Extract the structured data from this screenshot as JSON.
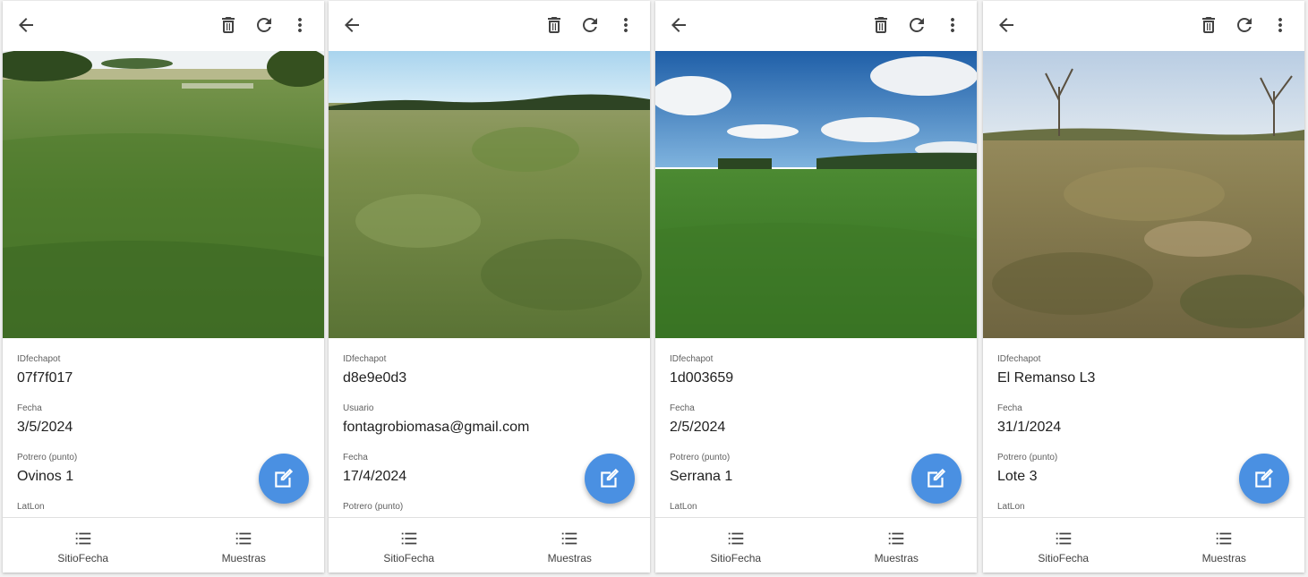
{
  "colors": {
    "fab": "#4a90e2",
    "toolbar": "#ffffff",
    "icon": "#424242"
  },
  "icons": {
    "back": "arrow-back-icon",
    "delete": "trash-icon",
    "refresh": "refresh-icon",
    "more": "more-vert-icon",
    "edit": "edit-icon",
    "nav": "list-icon"
  },
  "panels": [
    {
      "photo_desc_scene": "pasture-with-trees",
      "fields": [
        {
          "label": "IDfechapot",
          "value": "07f7f017"
        },
        {
          "label": "Fecha",
          "value": "3/5/2024"
        },
        {
          "label": "Potrero (punto)",
          "value": "Ovinos 1"
        },
        {
          "label": "LatLon",
          "value": ""
        }
      ],
      "nav": [
        {
          "label": "SitioFecha"
        },
        {
          "label": "Muestras"
        }
      ]
    },
    {
      "photo_desc_scene": "tall-grassland",
      "fields": [
        {
          "label": "IDfechapot",
          "value": "d8e9e0d3"
        },
        {
          "label": "Usuario",
          "value": "fontagrobiomasa@gmail.com"
        },
        {
          "label": "Fecha",
          "value": "17/4/2024"
        },
        {
          "label": "Potrero (punto)",
          "value": ""
        }
      ],
      "nav": [
        {
          "label": "SitioFecha"
        },
        {
          "label": "Muestras"
        }
      ]
    },
    {
      "photo_desc_scene": "green-field-cloudy-sky",
      "fields": [
        {
          "label": "IDfechapot",
          "value": "1d003659"
        },
        {
          "label": "Fecha",
          "value": "2/5/2024"
        },
        {
          "label": "Potrero (punto)",
          "value": "Serrana 1"
        },
        {
          "label": "LatLon",
          "value": ""
        }
      ],
      "nav": [
        {
          "label": "SitioFecha"
        },
        {
          "label": "Muestras"
        }
      ]
    },
    {
      "photo_desc_scene": "dry-shrubland",
      "fields": [
        {
          "label": "IDfechapot",
          "value": "El Remanso L3"
        },
        {
          "label": "Fecha",
          "value": "31/1/2024"
        },
        {
          "label": "Potrero (punto)",
          "value": "Lote 3"
        },
        {
          "label": "LatLon",
          "value": ""
        }
      ],
      "nav": [
        {
          "label": "SitioFecha"
        },
        {
          "label": "Muestras"
        }
      ]
    }
  ]
}
